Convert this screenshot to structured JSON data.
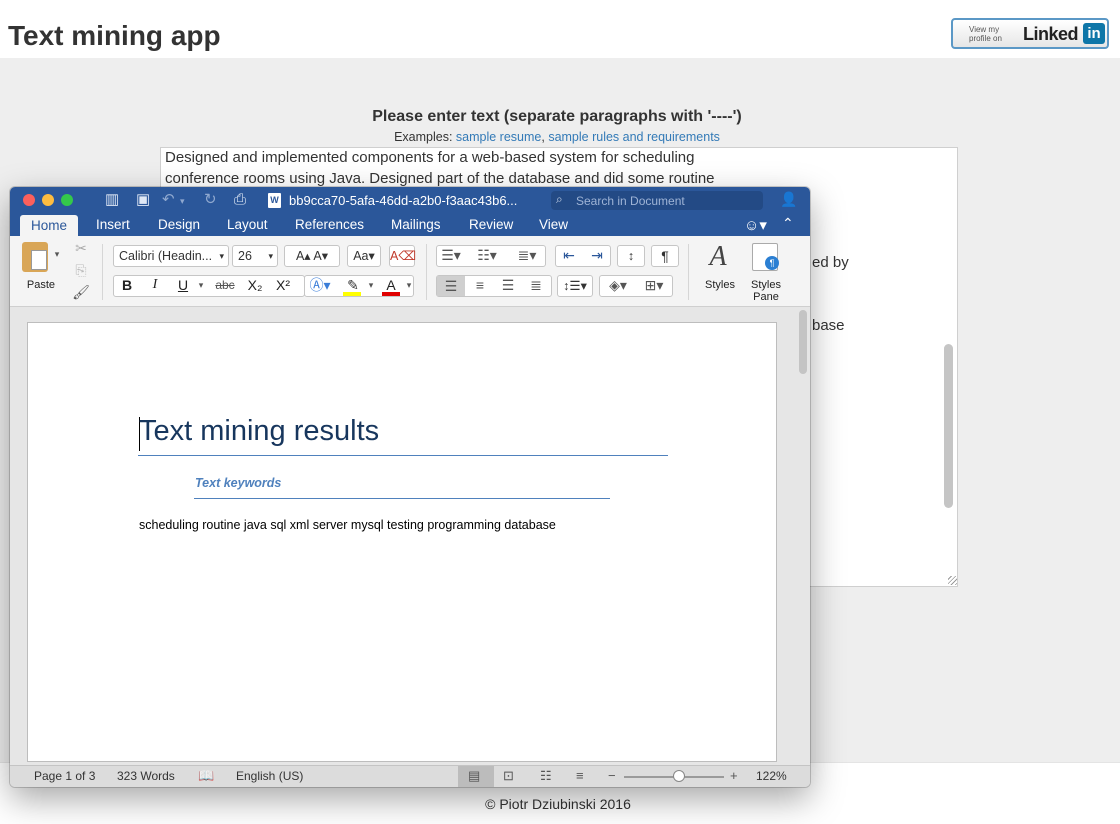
{
  "site": {
    "title": "Text mining app",
    "linkedin": {
      "line1": "View my",
      "line2": "profile on",
      "word": "Linked",
      "box": "in"
    }
  },
  "form": {
    "heading": "Please enter text (separate paragraphs with '----')",
    "examples_label": "Examples: ",
    "example_link_1": "sample resume",
    "example_sep": ", ",
    "example_link_2": "sample rules and requirements",
    "textarea_lines": [
      "Designed and implemented components for a web-based system for scheduling",
      "conference rooms using Java. Designed part of the database and did some routine"
    ],
    "partial_1": "ed by",
    "partial_2": "base"
  },
  "footer": {
    "text": "© Piotr Dziubinski 2016"
  },
  "word": {
    "document_name": "bb9cca70-5afa-46dd-a2b0-f3aac43b6...",
    "search_placeholder": "Search in Document",
    "tabs": [
      "Home",
      "Insert",
      "Design",
      "Layout",
      "References",
      "Mailings",
      "Review",
      "View"
    ],
    "active_tab": "Home",
    "ribbon": {
      "paste_label": "Paste",
      "font_name": "Calibri (Headin...",
      "font_size": "26",
      "styles_label": "Styles",
      "styles_pane_label_1": "Styles",
      "styles_pane_label_2": "Pane",
      "bold": "B",
      "italic": "I",
      "underline": "U",
      "strikethrough": "abc",
      "subscript": "X₂",
      "superscript": "X²",
      "pilcrow": "¶"
    },
    "document": {
      "title": "Text mining results",
      "subtitle": "Text keywords",
      "keywords": "scheduling routine java sql xml server mysql testing programming database"
    },
    "status": {
      "page": "Page 1 of 3",
      "words": "323 Words",
      "language": "English (US)",
      "zoom": "122%",
      "zoom_level": 0.55
    }
  },
  "colors": {
    "word_blue": "#2b579a",
    "link": "#337ab7",
    "heading_navy": "#17365d",
    "accent": "#4f81bd",
    "highlight_yellow": "#ffff00",
    "font_red": "#e00000"
  }
}
